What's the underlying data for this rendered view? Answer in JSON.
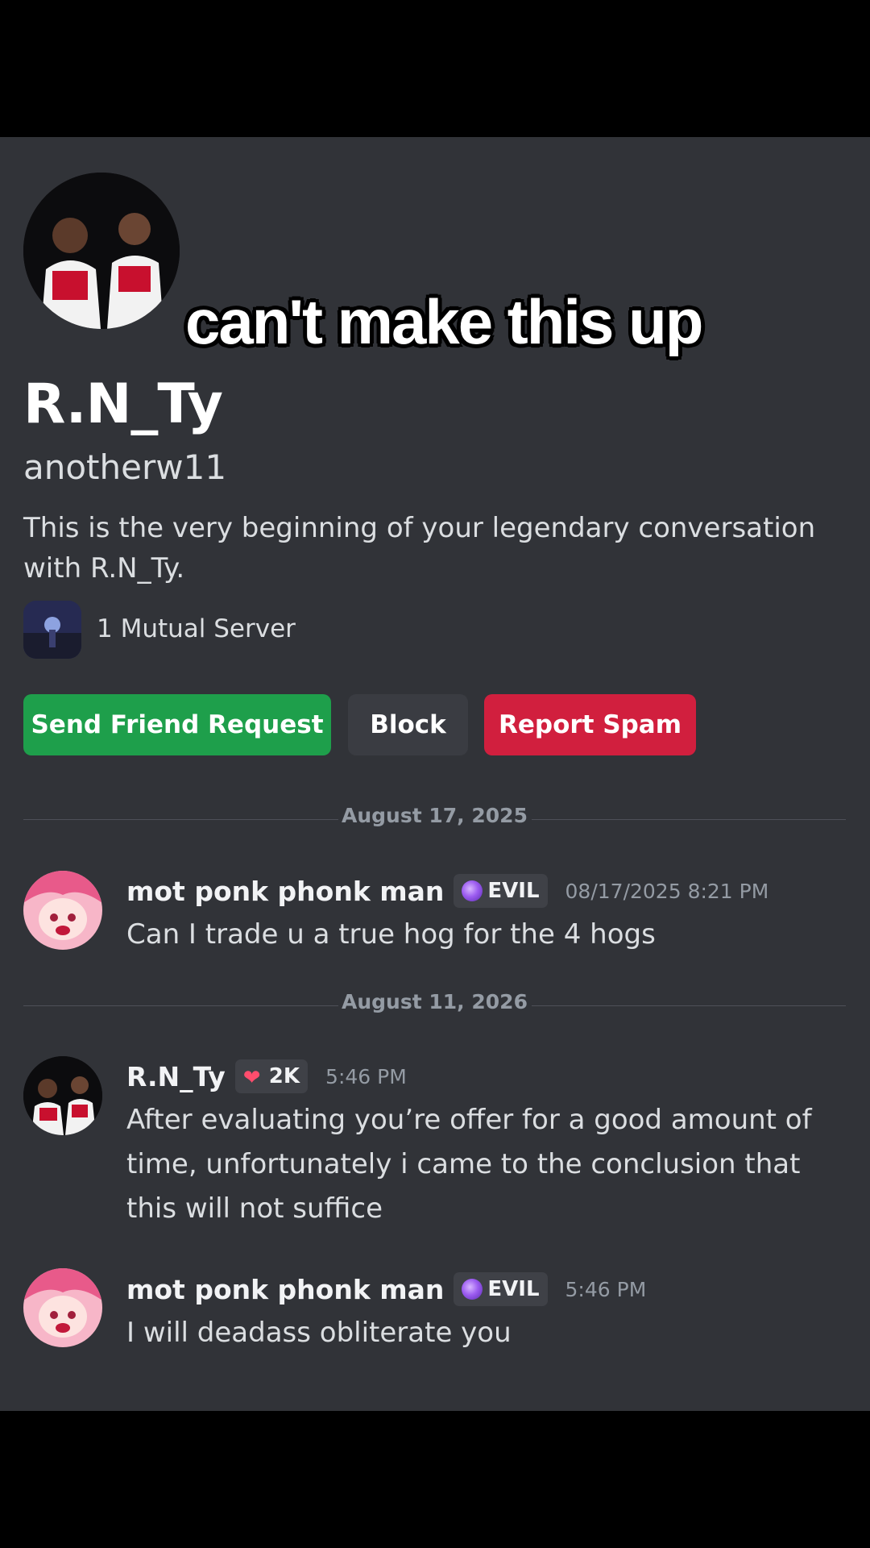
{
  "overlay": {
    "caption": "can't make this up"
  },
  "profile": {
    "display_name": "R.N_Ty",
    "username": "anotherw11",
    "intro": "This is the very beginning of your legendary conversation with R.N_Ty.",
    "mutual_servers": "1 Mutual Server"
  },
  "actions": {
    "friend_request": "Send Friend Request",
    "block": "Block",
    "report_spam": "Report Spam"
  },
  "colors": {
    "background": "#313338",
    "green": "#1e9f4b",
    "red": "#d11f3e",
    "grey": "#3a3c42"
  },
  "dividers": [
    "August 17, 2025",
    "August 11, 2026"
  ],
  "messages": [
    {
      "author": "mot ponk phonk man",
      "tag": "EVIL",
      "tag_icon": "evil-orb-icon",
      "time": "08/17/2025 8:21 PM",
      "text": "Can I trade u a true hog for the 4 hogs"
    },
    {
      "author": "R.N_Ty",
      "tag": "2K",
      "tag_icon": "heart-icon",
      "time": "5:46 PM",
      "text": "After evaluating you’re offer for a good amount of time, unfortunately i came to the conclusion that this will not suffice"
    },
    {
      "author": "mot ponk phonk man",
      "tag": "EVIL",
      "tag_icon": "evil-orb-icon",
      "time": "5:46 PM",
      "text": "I will deadass obliterate you"
    }
  ]
}
